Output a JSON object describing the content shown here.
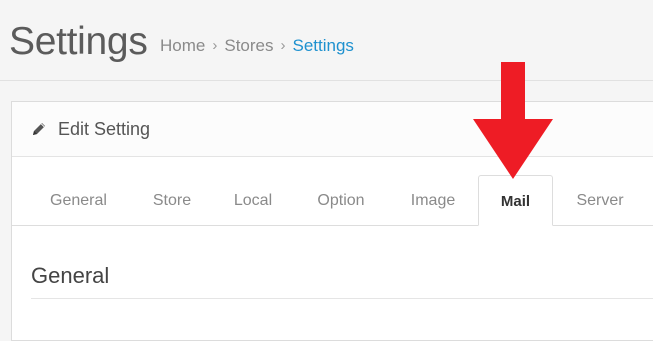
{
  "header": {
    "title": "Settings",
    "breadcrumb": [
      {
        "label": "Home",
        "active": false
      },
      {
        "label": "Stores",
        "active": false
      },
      {
        "label": "Settings",
        "active": true
      }
    ],
    "separator": "›"
  },
  "panel": {
    "title": "Edit Setting",
    "title_icon": "pencil-icon"
  },
  "tabs": [
    {
      "label": "General",
      "active": false
    },
    {
      "label": "Store",
      "active": false
    },
    {
      "label": "Local",
      "active": false
    },
    {
      "label": "Option",
      "active": false
    },
    {
      "label": "Image",
      "active": false
    },
    {
      "label": "Mail",
      "active": true
    },
    {
      "label": "Server",
      "active": false
    }
  ],
  "section": {
    "title": "General"
  },
  "annotation": {
    "icon": "down-arrow-icon",
    "color": "#ee1c25"
  },
  "colors": {
    "link": "#1e91cf",
    "arrow": "#ee1c25"
  }
}
